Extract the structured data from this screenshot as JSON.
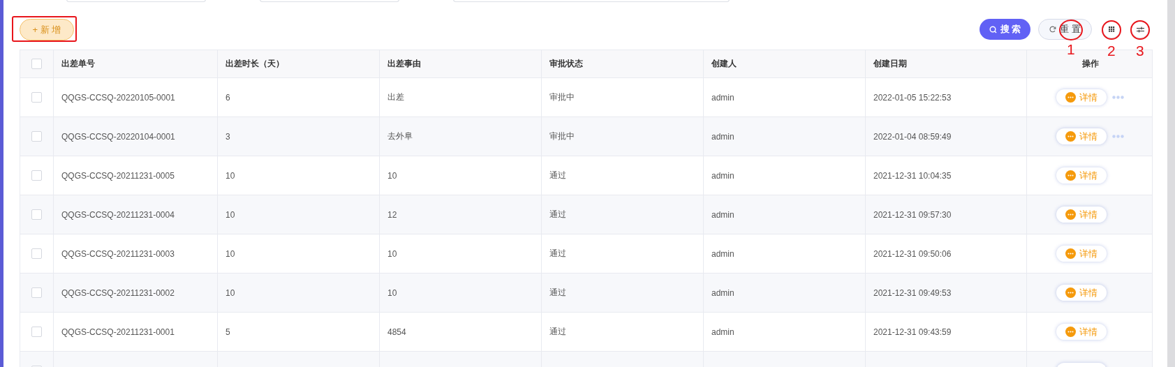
{
  "filters": [
    {
      "kind": "field"
    },
    {
      "kind": "field"
    },
    {
      "kind": "field"
    }
  ],
  "toolbar": {
    "add_button": {
      "icon": "+",
      "label": "新 增"
    },
    "search_button": {
      "label": "搜 索"
    },
    "reset_button": {
      "label": "重 置"
    }
  },
  "annotations": [
    {
      "label": "1"
    },
    {
      "label": "2"
    },
    {
      "label": "3"
    }
  ],
  "table": {
    "header_checked": false,
    "columns": [
      "出差单号",
      "出差时长（天）",
      "出差事由",
      "审批状态",
      "创建人",
      "创建日期",
      "操作"
    ],
    "rows": [
      {
        "checked": false,
        "cells": [
          "QQGS-CCSQ-20220105-0001",
          "6",
          "出差",
          "审批中",
          "admin",
          "2022-01-05 15:22:53"
        ],
        "action": "详情",
        "has_more": true
      },
      {
        "checked": false,
        "cells": [
          "QQGS-CCSQ-20220104-0001",
          "3",
          "去外阜",
          "审批中",
          "admin",
          "2022-01-04 08:59:49"
        ],
        "action": "详情",
        "has_more": true
      },
      {
        "checked": false,
        "cells": [
          "QQGS-CCSQ-20211231-0005",
          "10",
          "10",
          "通过",
          "admin",
          "2021-12-31 10:04:35"
        ],
        "action": "详情",
        "has_more": false
      },
      {
        "checked": false,
        "cells": [
          "QQGS-CCSQ-20211231-0004",
          "10",
          "12",
          "通过",
          "admin",
          "2021-12-31 09:57:30"
        ],
        "action": "详情",
        "has_more": false
      },
      {
        "checked": false,
        "cells": [
          "QQGS-CCSQ-20211231-0003",
          "10",
          "10",
          "通过",
          "admin",
          "2021-12-31 09:50:06"
        ],
        "action": "详情",
        "has_more": false
      },
      {
        "checked": false,
        "cells": [
          "QQGS-CCSQ-20211231-0002",
          "10",
          "10",
          "通过",
          "admin",
          "2021-12-31 09:49:53"
        ],
        "action": "详情",
        "has_more": false
      },
      {
        "checked": false,
        "cells": [
          "QQGS-CCSQ-20211231-0001",
          "5",
          "4854",
          "通过",
          "admin",
          "2021-12-31 09:43:59"
        ],
        "action": "详情",
        "has_more": false
      }
    ],
    "partial_row": {
      "checked": false
    }
  }
}
